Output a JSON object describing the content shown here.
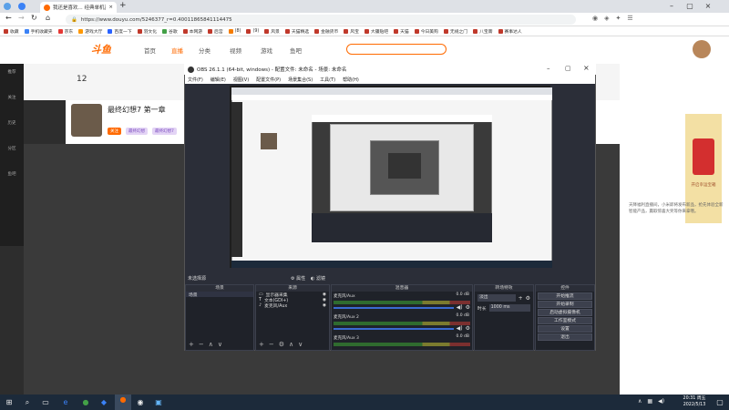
{
  "browser": {
    "tab_title": "我还是喜欢... 经典单机直播...",
    "url": "https://www.douyu.com/5246377_r=0.40011865841114475",
    "bookmarks": [
      "收藏",
      "手机收藏夹",
      "京东",
      "游戏大厅",
      "百度一下",
      "羽文化",
      "...",
      "谷歌",
      "本网游",
      "后宫",
      "(8)",
      "(9)",
      "风景",
      "天猫精选",
      "金融货币",
      "风宝",
      "大疆贴吧",
      "天猫",
      "今日美购",
      "无规之门",
      "八宝斋",
      "赛事达人",
      "..."
    ]
  },
  "douyu": {
    "logo": "斗鱼",
    "nav": [
      "首页",
      "直播",
      "分类",
      "视频",
      "游戏",
      "鱼吧"
    ],
    "search_placeholder": "",
    "left_sidebar": [
      "推荐",
      "关注",
      "历史",
      "分区",
      "鱼吧"
    ],
    "follow_count": "12",
    "stream_title": "最终幻想7 第一章",
    "streamer_tags": [
      "关注",
      "最终幻想",
      "最终幻想7"
    ],
    "right_text": "天降福利直播间，小米即将发布新品，抢先体验全新智能产品，赢取惊喜大奖等你来拿哦。",
    "promo_text": "开启幸运宝箱"
  },
  "obs": {
    "title": "OBS 26.1.1 (64-bit, windows) - 配置文件: 未命名 - 场景: 未命名",
    "menu": [
      "文件(F)",
      "编辑(E)",
      "视图(V)",
      "配置文件(P)",
      "场景集合(S)",
      "工具(T)",
      "帮助(H)"
    ],
    "scene_bar_label": "未选择源",
    "scene_bar_properties": "属性",
    "scene_bar_filters": "滤镜",
    "docks": {
      "scenes_header": "场景",
      "sources_header": "来源",
      "mixer_header": "混音器",
      "transitions_header": "转场特效",
      "controls_header": "控件"
    },
    "scenes": [
      "场景"
    ],
    "sources": [
      "显示器采集",
      "文本(GDI+)",
      "麦克风/Aux"
    ],
    "mixer": [
      {
        "name": "麦克风/Aux",
        "db": "0.0 dB"
      },
      {
        "name": "麦克风/Aux 2",
        "db": "0.0 dB"
      },
      {
        "name": "麦克风/Aux 3",
        "db": "0.0 dB"
      }
    ],
    "transition": {
      "type": "淡出",
      "duration_label": "时长",
      "duration": "1000 ms"
    },
    "controls": [
      "开始推流",
      "开始录制",
      "启动虚拟摄像机",
      "工作室模式",
      "设置",
      "退出"
    ]
  },
  "taskbar": {
    "time": "20:31 周五",
    "date": "2022/5/13"
  }
}
